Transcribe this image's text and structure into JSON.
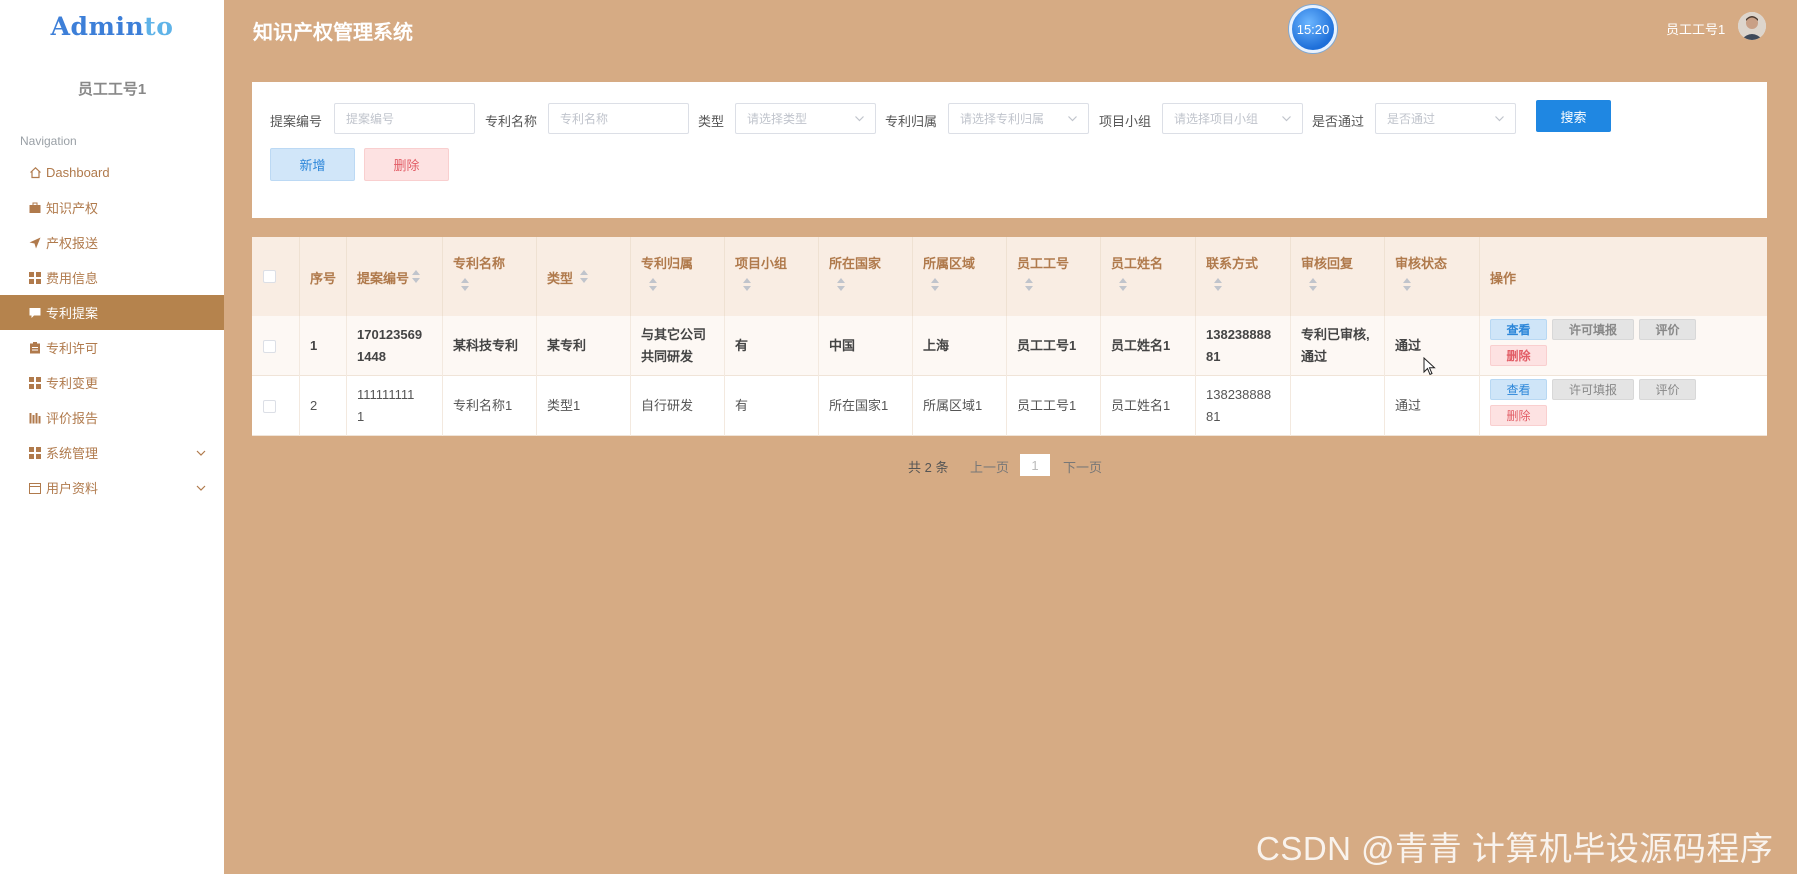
{
  "brand": {
    "logo_main": "Admin",
    "logo_accent": "to"
  },
  "sidebar": {
    "user_name": "员工工号1",
    "nav_heading": "Navigation",
    "items": [
      {
        "label": "Dashboard",
        "icon": "home-icon"
      },
      {
        "label": "知识产权",
        "icon": "briefcase-icon"
      },
      {
        "label": "产权报送",
        "icon": "send-icon"
      },
      {
        "label": "费用信息",
        "icon": "grid-icon"
      },
      {
        "label": "专利提案",
        "icon": "comment-icon",
        "active": true
      },
      {
        "label": "专利许可",
        "icon": "clipboard-icon"
      },
      {
        "label": "专利变更",
        "icon": "grid-icon"
      },
      {
        "label": "评价报告",
        "icon": "chart-icon"
      },
      {
        "label": "系统管理",
        "icon": "grid-icon",
        "has_submenu": true
      },
      {
        "label": "用户资料",
        "icon": "calendar-icon",
        "has_submenu": true
      }
    ]
  },
  "header": {
    "title": "知识产权管理系统",
    "clock": "15:20",
    "user": "员工工号1"
  },
  "search": {
    "fields": [
      {
        "label": "提案编号",
        "placeholder": "提案编号"
      },
      {
        "label": "专利名称",
        "placeholder": "专利名称"
      },
      {
        "label": "类型",
        "placeholder": "请选择类型"
      },
      {
        "label": "专利归属",
        "placeholder": "请选择专利归属"
      },
      {
        "label": "项目小组",
        "placeholder": "请选择项目小组"
      },
      {
        "label": "是否通过",
        "placeholder": "是否通过"
      }
    ],
    "search_button": "搜索",
    "add_button": "新增",
    "delete_button": "删除"
  },
  "table": {
    "columns": [
      "序号",
      "提案编号",
      "专利名称",
      "类型",
      "专利归属",
      "项目小组",
      "所在国家",
      "所属区域",
      "员工工号",
      "员工姓名",
      "联系方式",
      "审核回复",
      "审核状态",
      "操作"
    ],
    "rows": [
      {
        "index": "1",
        "proposal_no_a": "170123569",
        "proposal_no_b": "1448",
        "name": "某科技专利",
        "type": "某专利",
        "owner_a": "与其它公司",
        "owner_b": "共同研发",
        "group": "有",
        "country": "中国",
        "region": "上海",
        "emp_no": "员工工号1",
        "emp_name": "员工姓名1",
        "phone_a": "138238888",
        "phone_b": "81",
        "reply_a": "专利已审核,",
        "reply_b": "通过",
        "status": "通过"
      },
      {
        "index": "2",
        "proposal_no_a": "111111111",
        "proposal_no_b": "1",
        "name": "专利名称1",
        "type": "类型1",
        "owner_a": "自行研发",
        "owner_b": "",
        "group": "有",
        "country": "所在国家1",
        "region": "所属区域1",
        "emp_no": "员工工号1",
        "emp_name": "员工姓名1",
        "phone_a": "138238888",
        "phone_b": "81",
        "reply_a": "",
        "reply_b": "",
        "status": "通过"
      }
    ],
    "actions": {
      "view": "查看",
      "permit": "许可填报",
      "rate": "评价",
      "delete": "删除"
    }
  },
  "pagination": {
    "total": "共 2 条",
    "prev": "上一页",
    "page": "1",
    "next": "下一页"
  },
  "watermark": "CSDN @青青  计算机毕设源码程序",
  "colors": {
    "background": "#d6ab84",
    "sidebar_active": "#b5834d",
    "primary": "#1f87e2",
    "danger": "#e25d66",
    "header_cell": "#f9ede3"
  }
}
